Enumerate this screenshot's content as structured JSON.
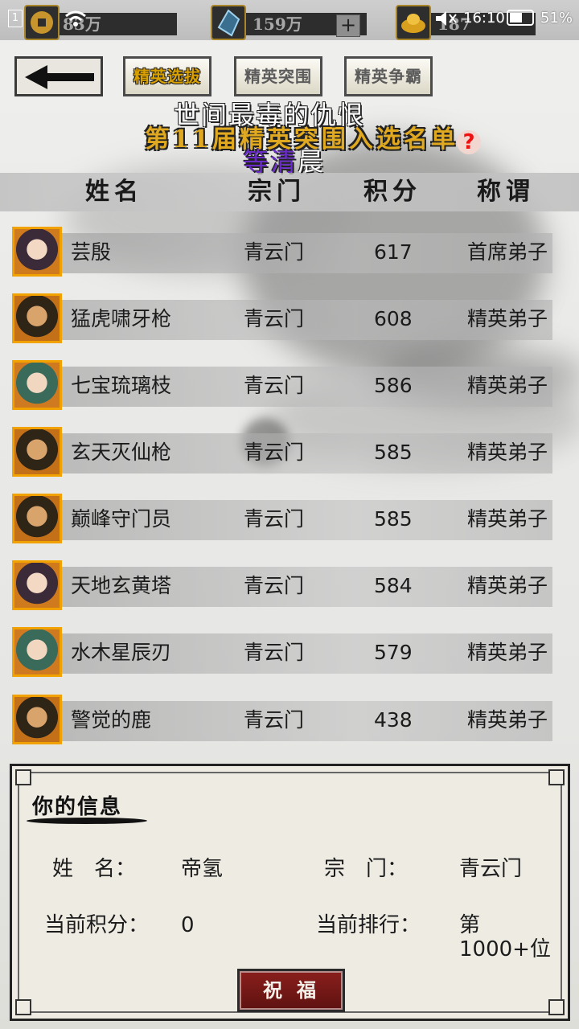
{
  "status_bar": {
    "badge1": "1",
    "badge2": "2",
    "time": "16:10",
    "battery": "51%"
  },
  "resources": {
    "gold_amount": "83万",
    "gem_amount": "159万",
    "third_amount": "187"
  },
  "tabs": [
    {
      "label": "精英选拔",
      "active": true
    },
    {
      "label": "精英突围",
      "active": false
    },
    {
      "label": "精英争霸",
      "active": false
    }
  ],
  "banner": {
    "title": "第11届精英突围入选名单",
    "help": "?"
  },
  "lyrics": {
    "line1": "世间最毒的仇恨",
    "line2_part1": "等清",
    "line2_part2": "晨"
  },
  "table": {
    "headers": [
      "姓名",
      "宗门",
      "积分",
      "称谓"
    ],
    "rows": [
      {
        "name": "芸殷",
        "sect": "青云门",
        "score": "617",
        "title": "首席弟子"
      },
      {
        "name": "猛虎啸牙枪",
        "sect": "青云门",
        "score": "608",
        "title": "精英弟子"
      },
      {
        "name": "七宝琉璃枝",
        "sect": "青云门",
        "score": "586",
        "title": "精英弟子"
      },
      {
        "name": "玄天灭仙枪",
        "sect": "青云门",
        "score": "585",
        "title": "精英弟子"
      },
      {
        "name": "巅峰守门员",
        "sect": "青云门",
        "score": "585",
        "title": "精英弟子"
      },
      {
        "name": "天地玄黄塔",
        "sect": "青云门",
        "score": "584",
        "title": "精英弟子"
      },
      {
        "name": "水木星辰刃",
        "sect": "青云门",
        "score": "579",
        "title": "精英弟子"
      },
      {
        "name": "警觉的鹿",
        "sect": "青云门",
        "score": "438",
        "title": "精英弟子"
      }
    ]
  },
  "my_info": {
    "title": "你的信息",
    "name_label": "姓　名：",
    "name_value": "帝氢",
    "sect_label": "宗　门：",
    "sect_value": "青云门",
    "score_label": "当前积分：",
    "score_value": "0",
    "rank_label": "当前排行：",
    "rank_value": "第1000+位",
    "bless_button": "祝福"
  }
}
